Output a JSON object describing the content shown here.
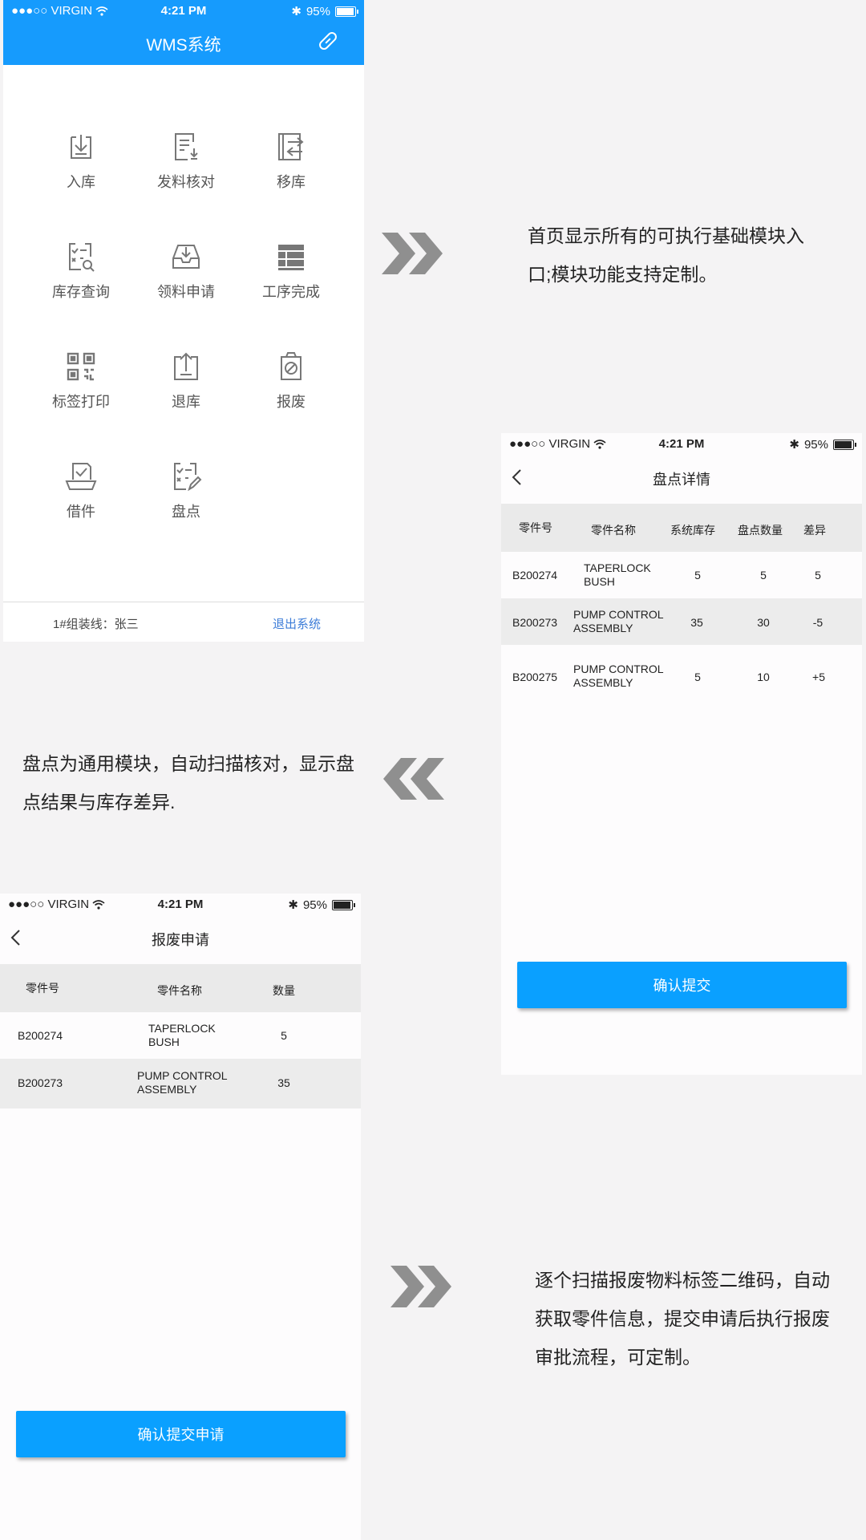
{
  "status_bar": {
    "carrier": "●●●○○ VIRGIN",
    "time": "4:21 PM",
    "battery_label": "95%",
    "battery_level": 0.95
  },
  "home": {
    "app_title": "WMS系统",
    "modules": [
      {
        "label": "入库",
        "icon": "inbound-tray-icon"
      },
      {
        "label": "发料核对",
        "icon": "issue-check-icon"
      },
      {
        "label": "移库",
        "icon": "transfer-icon"
      },
      {
        "label": "库存查询",
        "icon": "inventory-search-icon"
      },
      {
        "label": "领料申请",
        "icon": "inbox-download-icon"
      },
      {
        "label": "工序完成",
        "icon": "process-stack-icon"
      },
      {
        "label": "标签打印",
        "icon": "qr-code-icon"
      },
      {
        "label": "退库",
        "icon": "return-upload-icon"
      },
      {
        "label": "报废",
        "icon": "scrap-clipboard-icon"
      },
      {
        "label": "借件",
        "icon": "borrow-box-icon"
      },
      {
        "label": "盘点",
        "icon": "stocktake-edit-icon"
      }
    ],
    "line_info": "1#组装线：张三",
    "logout_label": "退出系统"
  },
  "descriptions": {
    "home": "首页显示所有的可执行基础模块入口;模块功能支持定制。",
    "stocktake": "盘点为通用模块，自动扫描核对，显示盘点结果与库存差异.",
    "scrap": "逐个扫描报废物料标签二维码，自动获取零件信息，提交申请后执行报废审批流程，可定制。"
  },
  "stocktake": {
    "title": "盘点详情",
    "columns": [
      "零件号",
      "零件名称",
      "系统库存",
      "盘点数量",
      "差异"
    ],
    "rows": [
      {
        "part_no": "B200274",
        "name_l1": "TAPERLOCK",
        "name_l2": "BUSH",
        "system_qty": "5",
        "count_qty": "5",
        "diff": "5"
      },
      {
        "part_no": "B200273",
        "name_l1": "PUMP CONTROL",
        "name_l2": "ASSEMBLY",
        "system_qty": "35",
        "count_qty": "30",
        "diff": "-5"
      },
      {
        "part_no": "B200275",
        "name_l1": "PUMP CONTROL",
        "name_l2": "ASSEMBLY",
        "system_qty": "5",
        "count_qty": "10",
        "diff": "+5"
      }
    ],
    "submit_label": "确认提交"
  },
  "scrap": {
    "title": "报废申请",
    "columns": [
      "零件号",
      "零件名称",
      "数量"
    ],
    "rows": [
      {
        "part_no": "B200274",
        "name_l1": "TAPERLOCK",
        "name_l2": "BUSH",
        "qty": "5"
      },
      {
        "part_no": "B200273",
        "name_l1": "PUMP CONTROL",
        "name_l2": "ASSEMBLY",
        "qty": "35"
      }
    ],
    "submit_label": "确认提交申请"
  }
}
